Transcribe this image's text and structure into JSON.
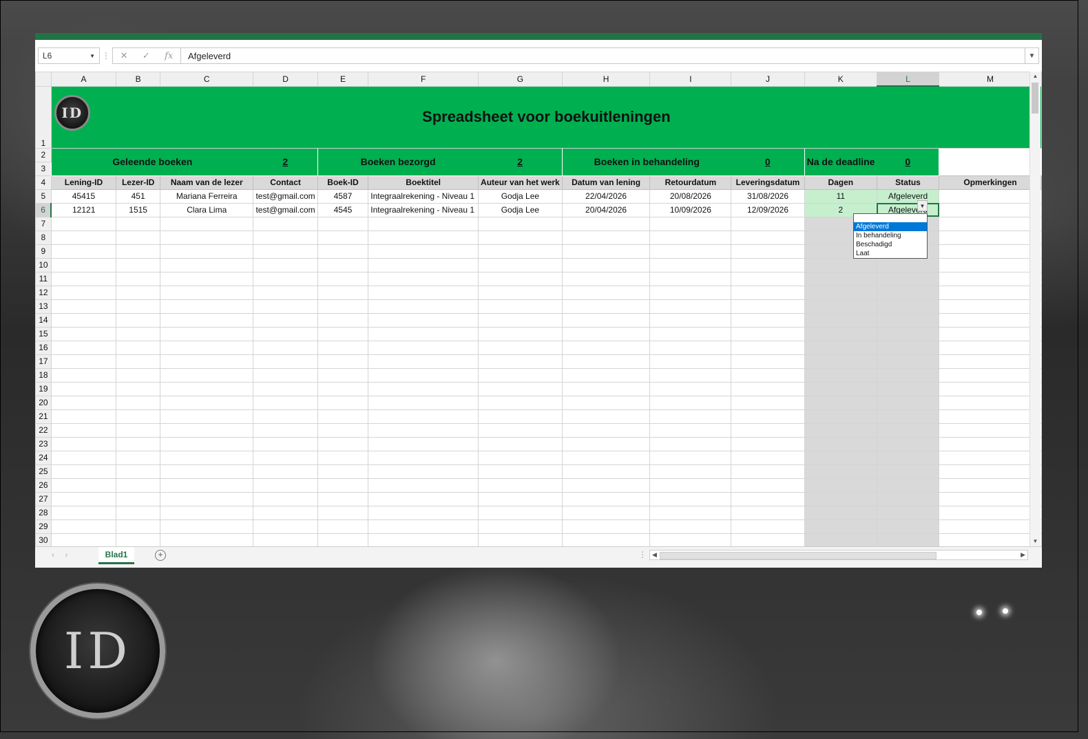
{
  "window": {
    "name_box": "L6",
    "formula_value": "Afgeleverd",
    "fx_label": "fx",
    "cancel_glyph": "✕",
    "enter_glyph": "✓"
  },
  "sheet": {
    "columns": [
      "A",
      "B",
      "C",
      "D",
      "E",
      "F",
      "G",
      "H",
      "I",
      "J",
      "K",
      "L",
      "M"
    ],
    "rows": [
      "1",
      "2",
      "3",
      "4",
      "5",
      "6",
      "7",
      "8",
      "9",
      "10",
      "11",
      "12",
      "13",
      "14",
      "15",
      "16",
      "17",
      "18",
      "19",
      "20",
      "21",
      "22",
      "23",
      "24",
      "25",
      "26",
      "27",
      "28",
      "29",
      "30"
    ],
    "logo_text": "ID",
    "title": "Spreadsheet voor boekuitleningen",
    "kpis": [
      {
        "label": "Geleende boeken",
        "value": "2"
      },
      {
        "label": "Boeken bezorgd",
        "value": "2"
      },
      {
        "label": "Boeken in behandeling",
        "value": "0"
      },
      {
        "label": "Na de deadline",
        "value": "0"
      }
    ],
    "headers": [
      "Lening-ID",
      "Lezer-ID",
      "Naam van de lezer",
      "Contact",
      "Boek-ID",
      "Boektitel",
      "Auteur van het werk",
      "Datum van lening",
      "Retourdatum",
      "Leveringsdatum",
      "Dagen",
      "Status",
      "Opmerkingen"
    ],
    "data_rows": [
      [
        "45415",
        "451",
        "Mariana Ferreira",
        "test@gmail.com",
        "4587",
        "Integraalrekening - Niveau 1",
        "Godja Lee",
        "22/04/2026",
        "20/08/2026",
        "31/08/2026",
        "11",
        "Afgeleverd",
        ""
      ],
      [
        "12121",
        "1515",
        "Clara Lima",
        "test@gmail.com",
        "4545",
        "Integraalrekening - Niveau 1",
        "Godja Lee",
        "20/04/2026",
        "10/09/2026",
        "12/09/2026",
        "2",
        "Afgeleverd",
        ""
      ]
    ],
    "status_dropdown": [
      "Afgeleverd",
      "In behandeling",
      "Beschadigd",
      "Laat"
    ],
    "status_selected": "Afgeleverd"
  },
  "bottom": {
    "sheet_tab": "Blad1",
    "add_sheet_glyph": "+"
  },
  "background": {
    "logo_text": "ID"
  }
}
